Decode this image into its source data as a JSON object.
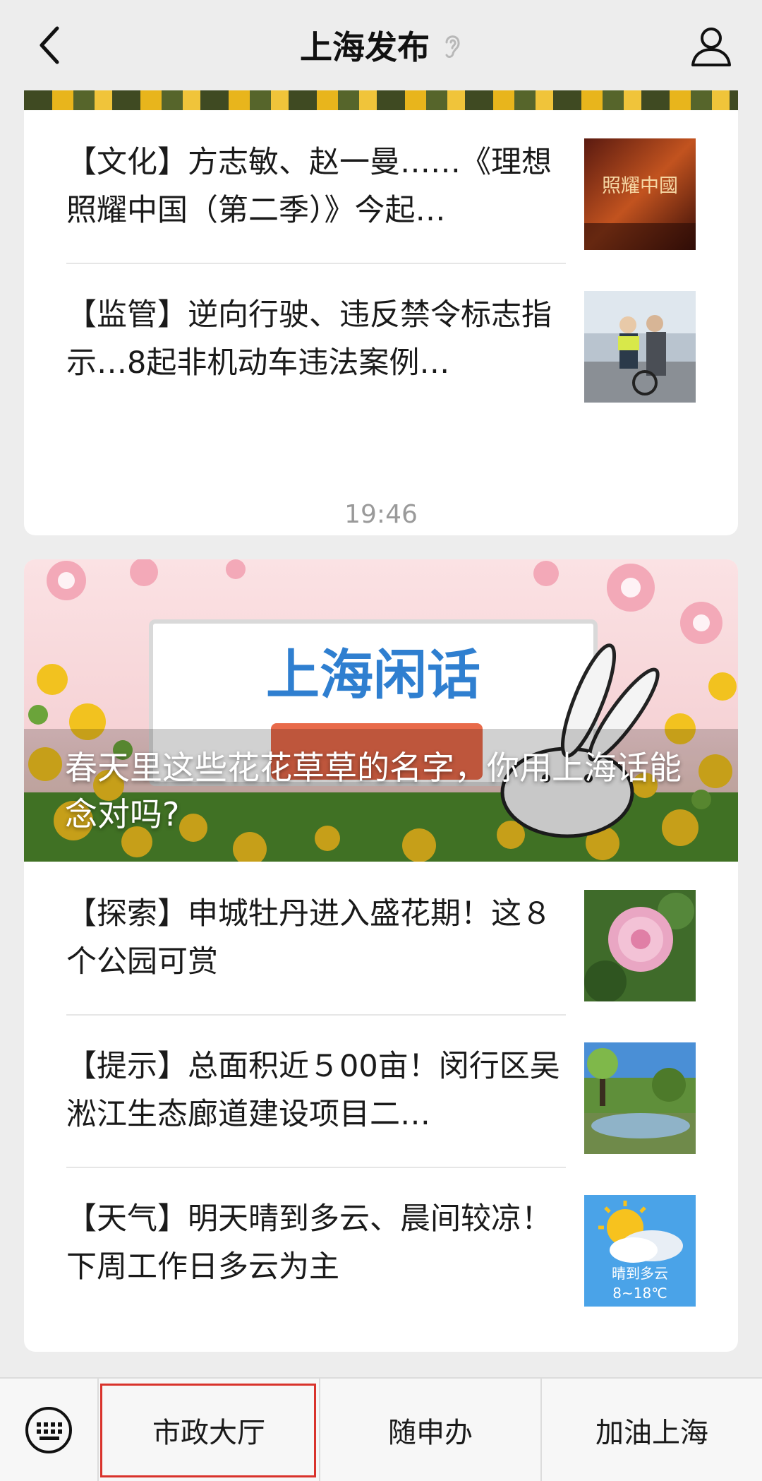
{
  "header": {
    "title": "上海发布"
  },
  "feed": {
    "group1": {
      "articles": [
        {
          "text": "【文化】方志敏、赵一曼……《理想照耀中国（第二季）》今起…",
          "thumb_caption": "照耀中國"
        },
        {
          "text": "【监管】逆向行驶、违反禁令标志指示…8起非机动车违法案例…"
        }
      ]
    },
    "timestamp": "19:46",
    "group2": {
      "hero": {
        "title": "春天里这些花花草草的名字，你用上海话能念对吗?",
        "image_text": "上海闲话"
      },
      "articles": [
        {
          "text": "【探索】申城牡丹进入盛花期！这８个公园可赏"
        },
        {
          "text": "【提示】总面积近５00亩！闵行区吴淞江生态廊道建设项目二…"
        },
        {
          "text": "【天气】明天晴到多云、晨间较凉！下周工作日多云为主",
          "thumb_caption": "晴到多云",
          "thumb_temp": "8~18℃"
        }
      ]
    }
  },
  "bottom_menu": {
    "items": [
      "市政大厅",
      "随申办",
      "加油上海"
    ]
  }
}
